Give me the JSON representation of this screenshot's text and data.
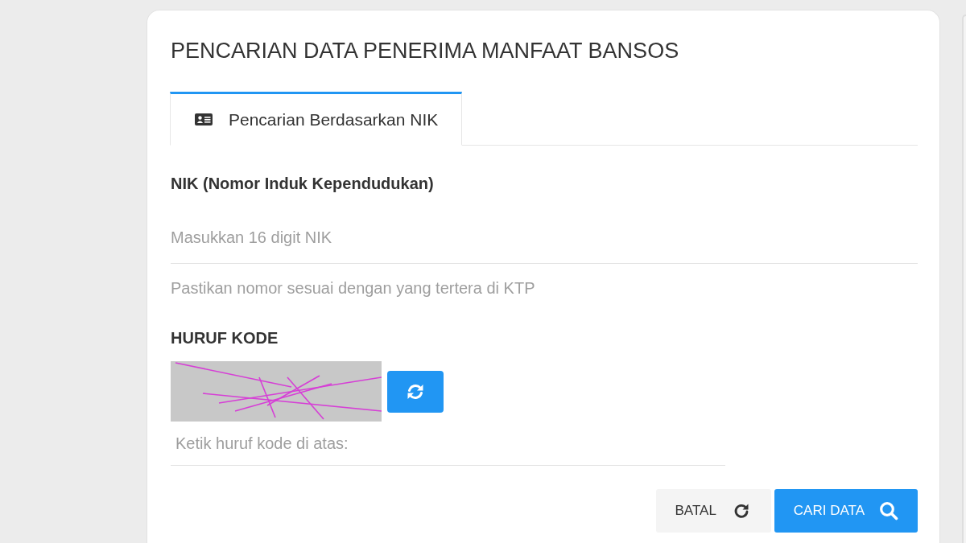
{
  "page": {
    "title": "PENCARIAN DATA PENERIMA MANFAAT BANSOS"
  },
  "tabs": [
    {
      "label": "Pencarian Berdasarkan NIK",
      "selected": true
    }
  ],
  "nik_field": {
    "label": "NIK (Nomor Induk Kependudukan)",
    "placeholder": "Masukkan 16 digit NIK",
    "help": "Pastikan nomor sesuai dengan yang tertera di KTP"
  },
  "captcha": {
    "label": "HURUF KODE",
    "placeholder": "Ketik huruf kode di atas:"
  },
  "buttons": [
    {
      "label": "BATAL",
      "kind": "cancel"
    },
    {
      "label": "CARI DATA",
      "kind": "search"
    }
  ]
}
